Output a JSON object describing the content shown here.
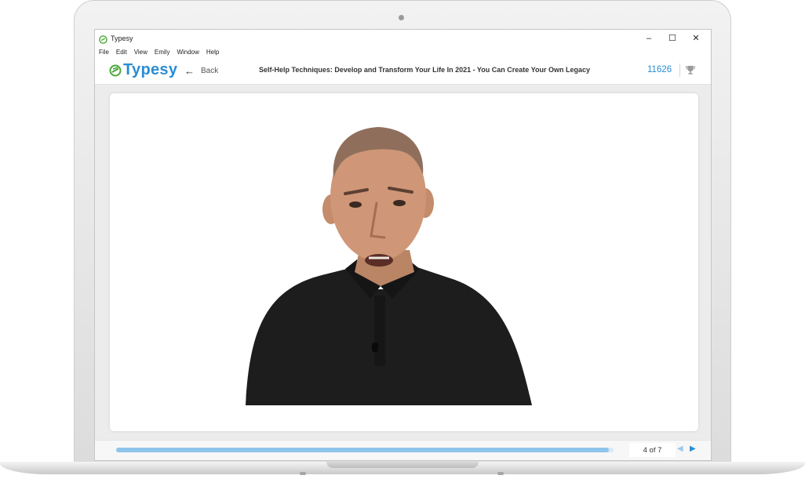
{
  "window": {
    "title": "Typesy",
    "controls": {
      "minimize": "–",
      "maximize": "☐",
      "close": "✕"
    }
  },
  "menu": [
    "File",
    "Edit",
    "View",
    "Emily",
    "Window",
    "Help"
  ],
  "header": {
    "logo_text": "Typesy",
    "back_label": "Back",
    "lesson_title": "Self-Help Techniques: Develop and Transform Your Life In 2021 - You Can Create Your Own Legacy",
    "score": "11626",
    "trophy_icon": "trophy-icon"
  },
  "player": {
    "progress": 0.99,
    "page_indicator": "4 of 7",
    "prev_icon": "triangle-left-icon",
    "next_icon": "triangle-right-icon"
  },
  "colors": {
    "brand": "#2a8dd4",
    "logo_green": "#4aa83a",
    "progress_fill": "#8fc4ec"
  }
}
